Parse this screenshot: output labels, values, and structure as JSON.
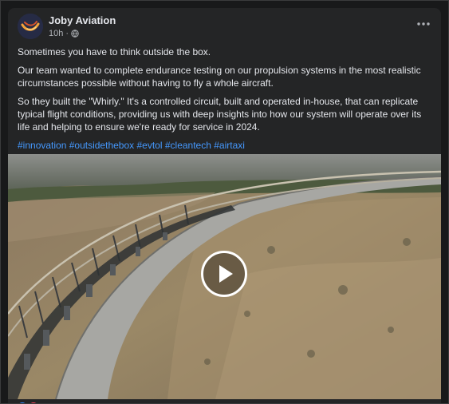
{
  "post": {
    "author": "Joby Aviation",
    "time": "10h",
    "separator": "·",
    "paragraphs": [
      "Sometimes you have to think outside the box.",
      "Our team wanted to complete endurance testing on our propulsion systems in the most realistic circumstances possible without having to fly a whole aircraft.",
      "So they built the \"Whirly.\" It's a controlled circuit, built and operated in-house, that can replicate typical flight conditions, providing us with deep insights into how our system will operate over its life and helping to ensure we're ready for service in 2024."
    ],
    "hashtags": [
      "#innovation",
      "#outsidethebox",
      "#evtol",
      "#cleantech",
      "#airtaxi"
    ]
  },
  "icons": {
    "privacy": "globe-icon",
    "more": "more-options-icon",
    "play": "play-icon"
  },
  "colors": {
    "card": "#242526",
    "page": "#18191a",
    "text": "#e4e6eb",
    "muted": "#b0b3b8",
    "link": "#4599ff"
  }
}
